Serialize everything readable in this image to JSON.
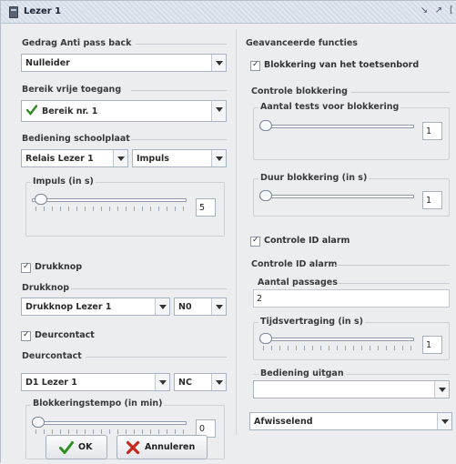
{
  "window": {
    "title": "Lezer 1",
    "icon": "lezer-window-icon",
    "controls": [
      "restore-icon",
      "maximize-icon"
    ]
  },
  "left": {
    "gedrag": {
      "label": "Gedrag Anti pass back",
      "value": "Nulleider"
    },
    "bereik": {
      "label": "Bereik vrije toegang",
      "value": "Bereik nr. 1",
      "icon": "green-checkmark-icon"
    },
    "bediening": {
      "label": "Bediening schoolplaat",
      "relais": "Relais  Lezer 1",
      "mode": "Impuls",
      "impuls": {
        "label": "Impuls (in s)",
        "value": "5",
        "fraction": 0.02
      }
    },
    "drukknop_check": {
      "label": "Drukknop",
      "checked": true
    },
    "drukknop": {
      "label": "Drukknop",
      "value": "Drukknop Lezer 1",
      "contact": "N0"
    },
    "deurcontact_check": {
      "label": "Deurcontact",
      "checked": true
    },
    "deurcontact": {
      "label": "Deurcontact",
      "value": "D1 Lezer 1",
      "contact": "NC",
      "tempo": {
        "label": "Blokkeringstempo (in min)",
        "value": "0",
        "fraction": 0.0
      }
    }
  },
  "right": {
    "geavanceerde_label": "Geavanceerde functies",
    "blokkering_check": {
      "label": "Blokkering van het toetsenbord",
      "checked": true
    },
    "controle_blokkering": {
      "label": "Controle blokkering",
      "tests": {
        "label": "Aantal tests voor blokkering",
        "value": "1",
        "fraction": 0.0
      },
      "duur": {
        "label": "Duur blokkering (in s)",
        "value": "1",
        "fraction": 0.0
      }
    },
    "controle_id_check": {
      "label": "Controle ID alarm",
      "checked": true
    },
    "controle_id": {
      "label": "Controle ID alarm",
      "passages": {
        "label": "Aantal passages",
        "value": "2"
      },
      "vertraging": {
        "label": "Tijdsvertraging (in s)",
        "value": "1",
        "fraction": 0.0
      },
      "uitgan": {
        "label": "Bediening uitgan",
        "value": ""
      },
      "mode": "Afwisselend"
    }
  },
  "buttons": {
    "ok": {
      "label": "OK",
      "icon": "green-checkmark-icon"
    },
    "cancel": {
      "label": "Annuleren",
      "icon": "red-x-icon"
    }
  }
}
